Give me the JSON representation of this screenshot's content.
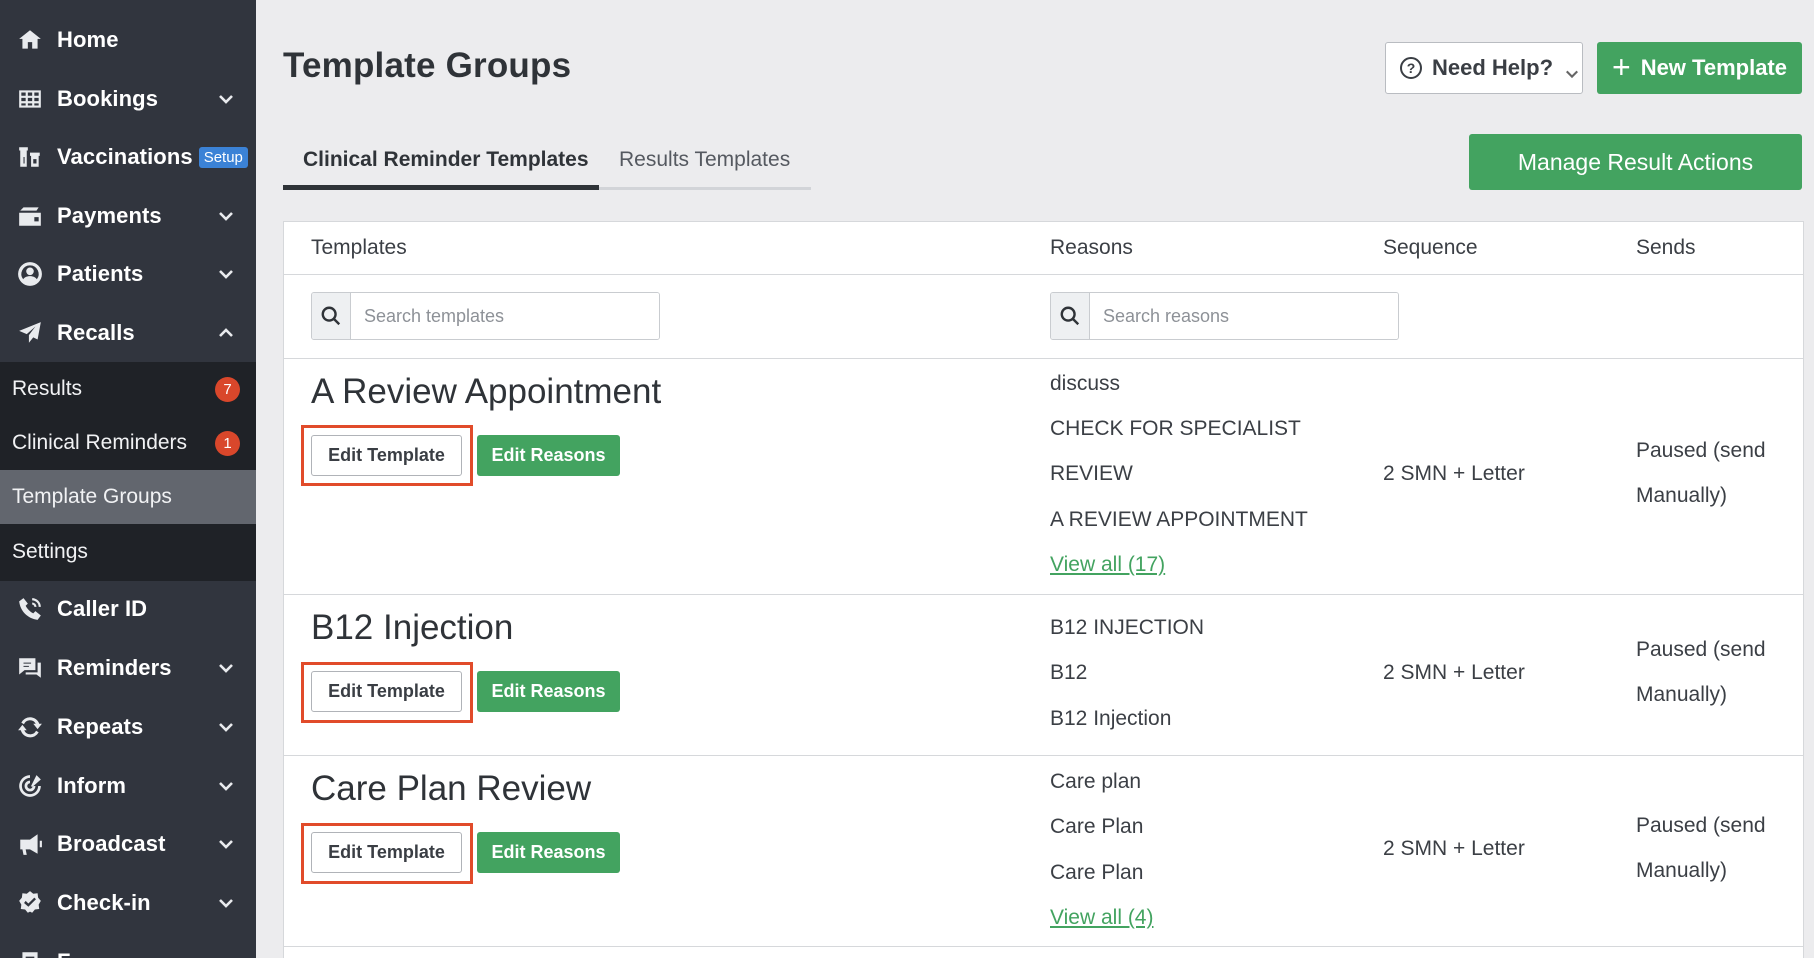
{
  "sidebar": {
    "items": [
      {
        "label": "Home",
        "icon": "home-icon"
      },
      {
        "label": "Bookings",
        "icon": "table-icon"
      },
      {
        "label": "Vaccinations",
        "icon": "vials-icon",
        "badge": "Setup"
      },
      {
        "label": "Payments",
        "icon": "wallet-icon"
      },
      {
        "label": "Patients",
        "icon": "user-circle-icon"
      },
      {
        "label": "Recalls",
        "icon": "paper-plane-icon"
      },
      {
        "label": "Caller ID",
        "icon": "phone-icon"
      },
      {
        "label": "Reminders",
        "icon": "chat-icon"
      },
      {
        "label": "Repeats",
        "icon": "refresh-icon"
      },
      {
        "label": "Inform",
        "icon": "target-icon"
      },
      {
        "label": "Broadcast",
        "icon": "megaphone-icon"
      },
      {
        "label": "Check-in",
        "icon": "check-badge-icon"
      },
      {
        "label": "F",
        "icon": "forms-icon"
      }
    ],
    "recalls_sub": [
      {
        "label": "Results",
        "count": "7"
      },
      {
        "label": "Clinical Reminders",
        "count": "1"
      },
      {
        "label": "Template Groups"
      },
      {
        "label": "Settings"
      }
    ]
  },
  "header": {
    "title": "Template Groups",
    "help_label": "Need Help?",
    "new_template_label": "New Template"
  },
  "tabs": [
    {
      "label": "Clinical Reminder Templates",
      "active": true
    },
    {
      "label": "Results Templates",
      "active": false
    }
  ],
  "manage_result_actions_label": "Manage Result Actions",
  "table": {
    "headers": {
      "templates": "Templates",
      "reasons": "Reasons",
      "sequence": "Sequence",
      "sends": "Sends"
    },
    "search_templates_placeholder": "Search templates",
    "search_reasons_placeholder": "Search reasons",
    "edit_template_label": "Edit Template",
    "edit_reasons_label": "Edit Reasons",
    "rows": [
      {
        "title": "A Review Appointment",
        "reasons": [
          "discuss",
          "CHECK FOR SPECIALIST",
          "REVIEW",
          "A REVIEW APPOINTMENT"
        ],
        "view_all": "View all (17)",
        "sequence": "2 SMN + Letter",
        "sends": "Paused (send Manually)"
      },
      {
        "title": "B12 Injection",
        "reasons": [
          "B12 INJECTION",
          "B12",
          "B12 Injection"
        ],
        "sequence": "2 SMN + Letter",
        "sends": "Paused (send Manually)"
      },
      {
        "title": "Care Plan Review",
        "reasons": [
          "Care plan",
          "Care Plan",
          "Care Plan"
        ],
        "view_all": "View all (4)",
        "sequence": "2 SMN + Letter",
        "sends": "Paused (send Manually)"
      }
    ]
  },
  "colors": {
    "sidebar_bg": "#31353e",
    "sidebar_sub_bg": "#1f2227",
    "accent_green": "#43a360",
    "highlight_red": "#e14b2a",
    "badge_red": "#d9472b",
    "setup_blue": "#3b82d6"
  }
}
